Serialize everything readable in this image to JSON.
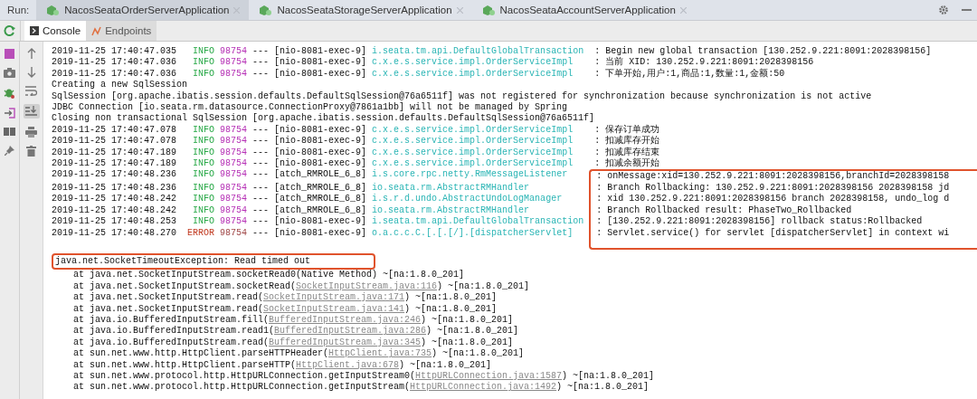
{
  "run_bar": {
    "label": "Run:",
    "tabs": [
      {
        "label": "NacosSeataOrderServerApplication",
        "selected": true
      },
      {
        "label": "NacosSeataStorageServerApplication",
        "selected": false
      },
      {
        "label": "NacosSeataAccountServerApplication",
        "selected": false
      }
    ]
  },
  "console_tabs": [
    {
      "label": "Console",
      "selected": true
    },
    {
      "label": "Endpoints",
      "selected": false
    }
  ],
  "scroll_to_end_on": true,
  "lines": [
    {
      "kind": "log",
      "timestamp": "2019-11-25 17:40:47.035",
      "level": "INFO",
      "color": "#27a846",
      "pid": {
        "text": "98754",
        "color": "#b52fb5"
      },
      "separator": "---",
      "thread": "[nio-8081-exec-9]",
      "logger": "i.seata.tm.api.DefaultGlobalTransaction",
      "message": ": Begin new global transaction [130.252.9.221:8091:2028398156]",
      "highlighted": false
    },
    {
      "kind": "log",
      "timestamp": "2019-11-25 17:40:47.036",
      "level": "INFO",
      "color": "#27a846",
      "pid": {
        "text": "98754",
        "color": "#b52fb5"
      },
      "separator": "---",
      "thread": "[nio-8081-exec-9]",
      "logger": "c.x.e.s.service.impl.OrderServiceImpl",
      "message": ": 当前 XID: 130.252.9.221:8091:2028398156",
      "highlighted": false
    },
    {
      "kind": "log",
      "timestamp": "2019-11-25 17:40:47.036",
      "level": "INFO",
      "color": "#27a846",
      "pid": {
        "text": "98754",
        "color": "#b52fb5"
      },
      "separator": "---",
      "thread": "[nio-8081-exec-9]",
      "logger": "c.x.e.s.service.impl.OrderServiceImpl",
      "message": ": 下单开始,用户:1,商品:1,数量:1,金额:50",
      "highlighted": false
    },
    {
      "kind": "text",
      "text": "Creating a new SqlSession"
    },
    {
      "kind": "text",
      "text": "SqlSession [org.apache.ibatis.session.defaults.DefaultSqlSession@76a6511f] was not registered for synchronization because synchronization is not active"
    },
    {
      "kind": "text",
      "text": "JDBC Connection [io.seata.rm.datasource.ConnectionProxy@7861a1bb] will not be managed by Spring"
    },
    {
      "kind": "text",
      "text": "Closing non transactional SqlSession [org.apache.ibatis.session.defaults.DefaultSqlSession@76a6511f]"
    },
    {
      "kind": "log",
      "timestamp": "2019-11-25 17:40:47.078",
      "level": "INFO",
      "color": "#27a846",
      "pid": {
        "text": "98754",
        "color": "#b52fb5"
      },
      "separator": "---",
      "thread": "[nio-8081-exec-9]",
      "logger": "c.x.e.s.service.impl.OrderServiceImpl",
      "message": ": 保存订单成功",
      "highlighted": false
    },
    {
      "kind": "log",
      "timestamp": "2019-11-25 17:40:47.078",
      "level": "INFO",
      "color": "#27a846",
      "pid": {
        "text": "98754",
        "color": "#b52fb5"
      },
      "separator": "---",
      "thread": "[nio-8081-exec-9]",
      "logger": "c.x.e.s.service.impl.OrderServiceImpl",
      "message": ": 扣减库存开始",
      "highlighted": false
    },
    {
      "kind": "log",
      "timestamp": "2019-11-25 17:40:47.189",
      "level": "INFO",
      "color": "#27a846",
      "pid": {
        "text": "98754",
        "color": "#b52fb5"
      },
      "separator": "---",
      "thread": "[nio-8081-exec-9]",
      "logger": "c.x.e.s.service.impl.OrderServiceImpl",
      "message": ": 扣减库存结束",
      "highlighted": false
    },
    {
      "kind": "log",
      "timestamp": "2019-11-25 17:40:47.189",
      "level": "INFO",
      "color": "#27a846",
      "pid": {
        "text": "98754",
        "color": "#b52fb5"
      },
      "separator": "---",
      "thread": "[nio-8081-exec-9]",
      "logger": "c.x.e.s.service.impl.OrderServiceImpl",
      "message": ": 扣减余额开始",
      "highlighted": false
    },
    {
      "kind": "log",
      "timestamp": "2019-11-25 17:40:48.236",
      "level": "INFO",
      "color": "#27a846",
      "pid": {
        "text": "98754",
        "color": "#b52fb5"
      },
      "separator": "---",
      "thread": "[atch_RMROLE_6_8]",
      "logger": "i.s.core.rpc.netty.RmMessageListener",
      "message": ": onMessage:xid=130.252.9.221:8091:2028398156,branchId=2028398158",
      "highlighted": true
    },
    {
      "kind": "log",
      "timestamp": "2019-11-25 17:40:48.236",
      "level": "INFO",
      "color": "#27a846",
      "pid": {
        "text": "98754",
        "color": "#b52fb5"
      },
      "separator": "---",
      "thread": "[atch_RMROLE_6_8]",
      "logger": "io.seata.rm.AbstractRMHandler",
      "message": ": Branch Rollbacking: 130.252.9.221:8091:2028398156 2028398158 jd",
      "highlighted": true
    },
    {
      "kind": "log",
      "timestamp": "2019-11-25 17:40:48.242",
      "level": "INFO",
      "color": "#27a846",
      "pid": {
        "text": "98754",
        "color": "#b52fb5"
      },
      "separator": "---",
      "thread": "[atch_RMROLE_6_8]",
      "logger": "i.s.r.d.undo.AbstractUndoLogManager",
      "message": ": xid 130.252.9.221:8091:2028398156 branch 2028398158, undo_log d",
      "highlighted": true
    },
    {
      "kind": "log",
      "timestamp": "2019-11-25 17:40:48.242",
      "level": "INFO",
      "color": "#27a846",
      "pid": {
        "text": "98754",
        "color": "#b52fb5"
      },
      "separator": "---",
      "thread": "[atch_RMROLE_6_8]",
      "logger": "io.seata.rm.AbstractRMHandler",
      "message": ": Branch Rollbacked result: PhaseTwo_Rollbacked",
      "highlighted": true
    },
    {
      "kind": "log",
      "timestamp": "2019-11-25 17:40:48.253",
      "level": "INFO",
      "color": "#27a846",
      "pid": {
        "text": "98754",
        "color": "#b52fb5"
      },
      "separator": "---",
      "thread": "[nio-8081-exec-9]",
      "logger": "i.seata.tm.api.DefaultGlobalTransaction",
      "message": ": [130.252.9.221:8091:2028398156] rollback status:Rollbacked",
      "highlighted": true
    },
    {
      "kind": "log",
      "timestamp": "2019-11-25 17:40:48.270",
      "level": "ERROR",
      "color": "#c23b22",
      "pid": {
        "text": "98754",
        "color": "#a04848"
      },
      "separator": "---",
      "thread": "[nio-8081-exec-9]",
      "logger": "o.a.c.c.C.[.[.[/].[dispatcherServlet]",
      "message": ": Servlet.service() for servlet [dispatcherServlet] in context wi",
      "highlighted": true
    },
    {
      "kind": "exception",
      "text": "java.net.SocketTimeoutException: Read timed out",
      "highlighted": true
    },
    {
      "kind": "frame",
      "text": "at java.net.SocketInputStream.socketRead0(Native Method) ~[na:1.8.0_201]"
    },
    {
      "kind": "frame",
      "text": "at java.net.SocketInputStream.socketRead(",
      "link": "SocketInputStream.java:116",
      "tail": ") ~[na:1.8.0_201]"
    },
    {
      "kind": "frame",
      "text": "at java.net.SocketInputStream.read(",
      "link": "SocketInputStream.java:171",
      "tail": ") ~[na:1.8.0_201]"
    },
    {
      "kind": "frame",
      "text": "at java.net.SocketInputStream.read(",
      "link": "SocketInputStream.java:141",
      "tail": ") ~[na:1.8.0_201]"
    },
    {
      "kind": "frame",
      "text": "at java.io.BufferedInputStream.fill(",
      "link": "BufferedInputStream.java:246",
      "tail": ") ~[na:1.8.0_201]"
    },
    {
      "kind": "frame",
      "text": "at java.io.BufferedInputStream.read1(",
      "link": "BufferedInputStream.java:286",
      "tail": ") ~[na:1.8.0_201]"
    },
    {
      "kind": "frame",
      "text": "at java.io.BufferedInputStream.read(",
      "link": "BufferedInputStream.java:345",
      "tail": ") ~[na:1.8.0_201]"
    },
    {
      "kind": "frame",
      "text": "at sun.net.www.http.HttpClient.parseHTTPHeader(",
      "link": "HttpClient.java:735",
      "tail": ") ~[na:1.8.0_201]"
    },
    {
      "kind": "frame",
      "text": "at sun.net.www.http.HttpClient.parseHTTP(",
      "link": "HttpClient.java:678",
      "tail": ") ~[na:1.8.0_201]"
    },
    {
      "kind": "frame",
      "text": "at sun.net.www.protocol.http.HttpURLConnection.getInputStream0(",
      "link": "HttpURLConnection.java:1587",
      "tail": ") ~[na:1.8.0_201]"
    },
    {
      "kind": "frame",
      "text": "at sun.net.www.protocol.http.HttpURLConnection.getInputStream(",
      "link": "HttpURLConnection.java:1492",
      "tail": ") ~[na:1.8.0_201]"
    }
  ]
}
